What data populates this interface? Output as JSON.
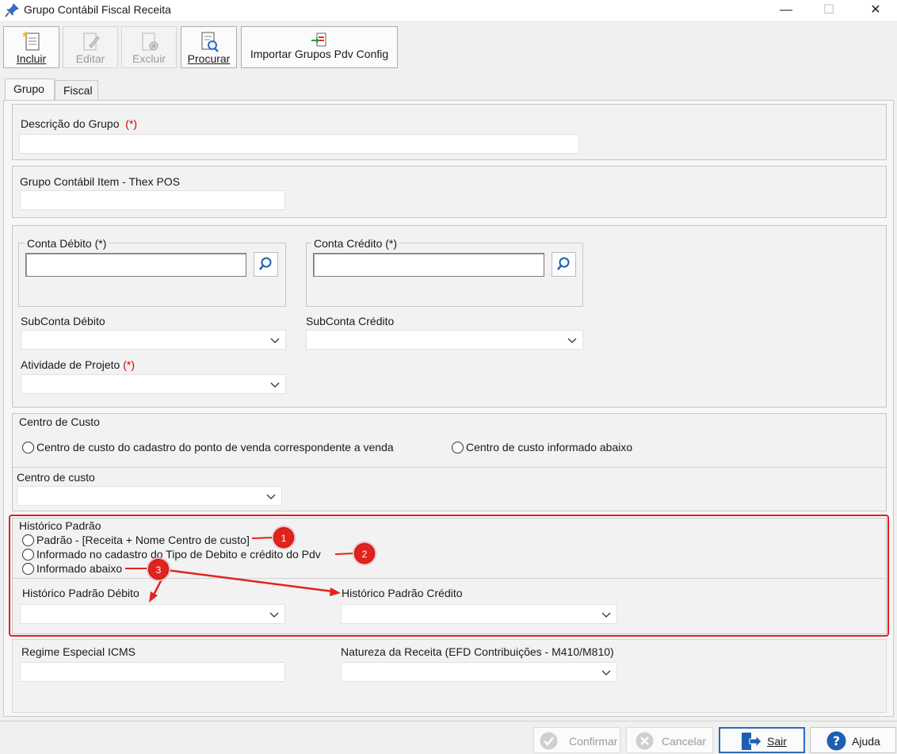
{
  "window": {
    "title": "Grupo Contábil Fiscal Receita",
    "minimize_glyph": "—",
    "maximize_glyph": "☐",
    "close_glyph": "✕"
  },
  "toolbar": {
    "incluir": "Incluir",
    "editar": "Editar",
    "excluir": "Excluir",
    "procurar": "Procurar",
    "importar": "Importar Grupos Pdv Config"
  },
  "tabs": [
    "Grupo",
    "Fiscal"
  ],
  "form": {
    "descricao_label": "Descrição do Grupo",
    "required_mark": "(*)",
    "descricao_value": "",
    "grupo_item_label": "Grupo Contábil Item - Thex POS",
    "grupo_item_value": "",
    "conta_debito_label": "Conta Débito (*)",
    "conta_credito_label": "Conta Crédito (*)",
    "subconta_debito_label": "SubConta Débito",
    "subconta_credito_label": "SubConta Crédito",
    "atividade_label": "Atividade de Projeto",
    "centro_custo_group": "Centro de Custo",
    "centro_opt1": "Centro de custo do cadastro do ponto de venda correspondente a venda",
    "centro_opt2": "Centro de custo informado abaixo",
    "centro_custo_label": "Centro de custo",
    "historico_group": "Histórico Padrão",
    "hist_opt1": "Padrão - [Receita + Nome Centro de custo]",
    "hist_opt2": "Informado no cadastro do Tipo de Debito e crédito do Pdv",
    "hist_opt3": "Informado abaixo",
    "hist_debito_label": "Histórico Padrão Débito",
    "hist_credito_label": "Histórico Padrão Crédito",
    "regime_label": "Regime Especial ICMS",
    "natureza_label": "Natureza da Receita (EFD Contribuições - M410/M810)"
  },
  "annotations": {
    "badges": [
      "1",
      "2",
      "3"
    ],
    "color": "#e1231f"
  },
  "bottom": {
    "confirmar": "Confirmar",
    "cancelar": "Cancelar",
    "sair": "Sair",
    "ajuda": "Ajuda"
  }
}
